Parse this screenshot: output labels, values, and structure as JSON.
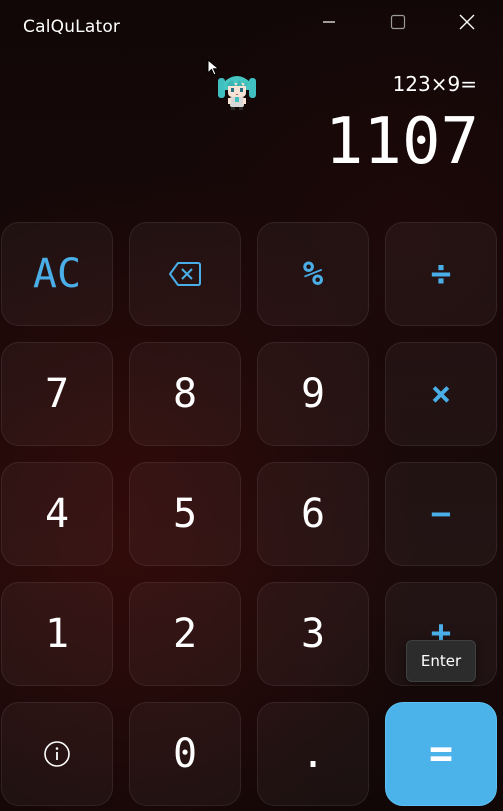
{
  "window": {
    "title": "CalQuLator",
    "controls": {
      "minimize_icon": "minimize-icon",
      "maximize_icon": "maximize-icon",
      "close_icon": "close-icon"
    }
  },
  "display": {
    "expression": "123×9=",
    "result": "1107"
  },
  "keypad": {
    "clear": "AC",
    "backspace_icon": "backspace-icon",
    "percent": "%",
    "divide": "÷",
    "seven": "7",
    "eight": "8",
    "nine": "9",
    "multiply": "×",
    "four": "4",
    "five": "5",
    "six": "6",
    "subtract": "−",
    "one": "1",
    "two": "2",
    "three": "3",
    "add": "+",
    "info_icon": "info-icon",
    "zero": "0",
    "decimal": ".",
    "equals": "="
  },
  "tooltip": {
    "text": "Enter"
  },
  "colors": {
    "accent": "#4cb2ea",
    "operator_text": "#4aaee8",
    "background": "#140808",
    "key_background": "#221414",
    "tooltip_background": "#2c2c2c"
  }
}
